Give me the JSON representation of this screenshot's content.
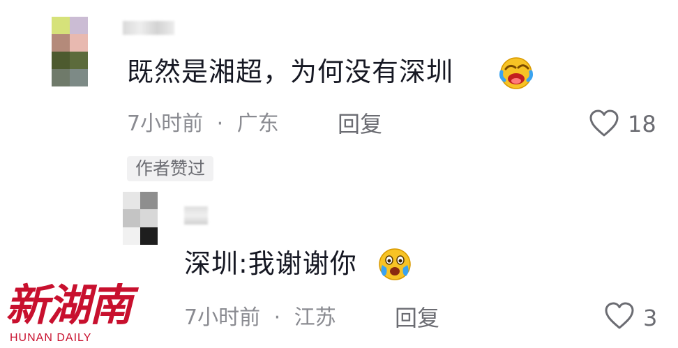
{
  "comments": [
    {
      "text": "既然是湘超，为何没有深圳",
      "emoji": "laughing-crying-face-icon",
      "time": "7小时前",
      "separator": "·",
      "location": "广东",
      "reply_label": "回复",
      "like_count": "18",
      "author_liked_badge": "作者赞过"
    }
  ],
  "replies": [
    {
      "text": "深圳:我谢谢你",
      "emoji": "teary-grinning-face-icon",
      "time": "7小时前",
      "separator": "·",
      "location": "江苏",
      "reply_label": "回复",
      "like_count": "3"
    }
  ],
  "watermark": {
    "logo_text": "新湖南",
    "english": "HUNAN DAILY",
    "color": "#c8102e"
  }
}
